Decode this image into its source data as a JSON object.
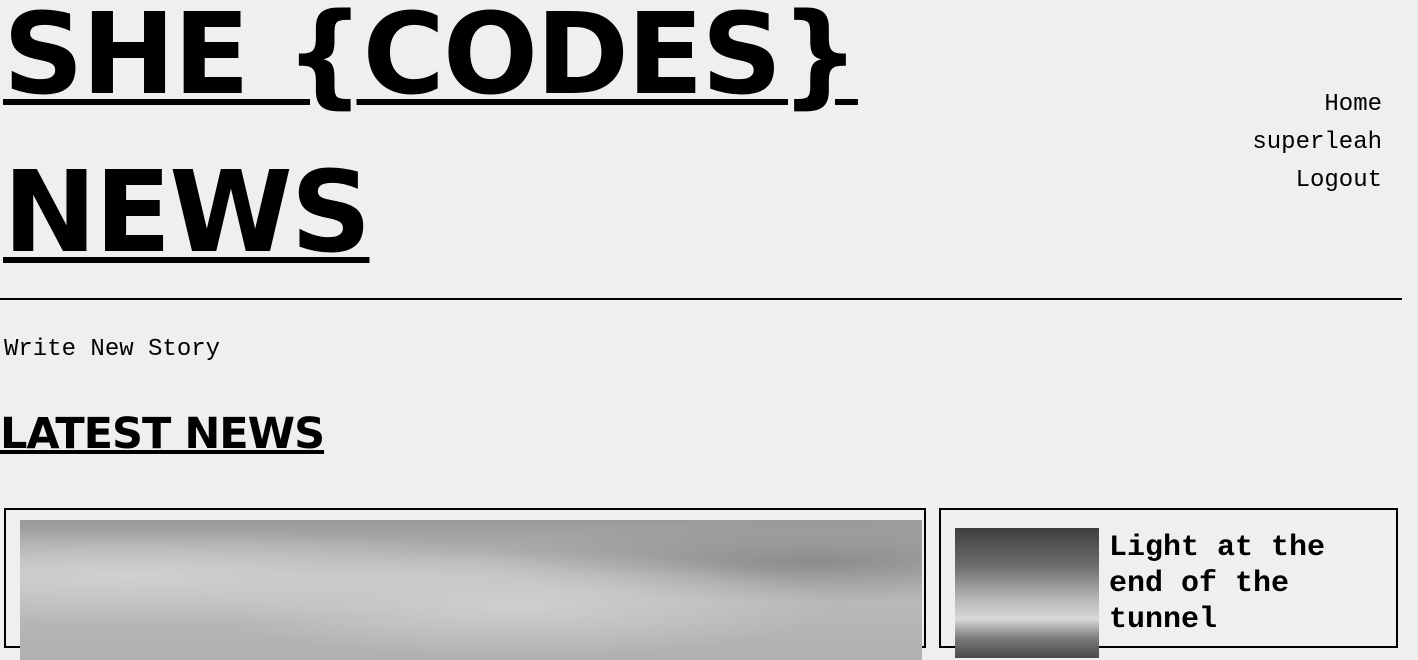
{
  "header": {
    "logo_line1": "SHE {CODES}",
    "logo_line2": "NEWS",
    "nav": {
      "home": "Home",
      "user": "superleah",
      "logout": "Logout"
    }
  },
  "main": {
    "write_story_label": "Write New Story",
    "section_title": "LATEST NEWS",
    "stories": [
      {
        "title": ""
      },
      {
        "title": "Light at the end of the tunnel"
      }
    ]
  }
}
